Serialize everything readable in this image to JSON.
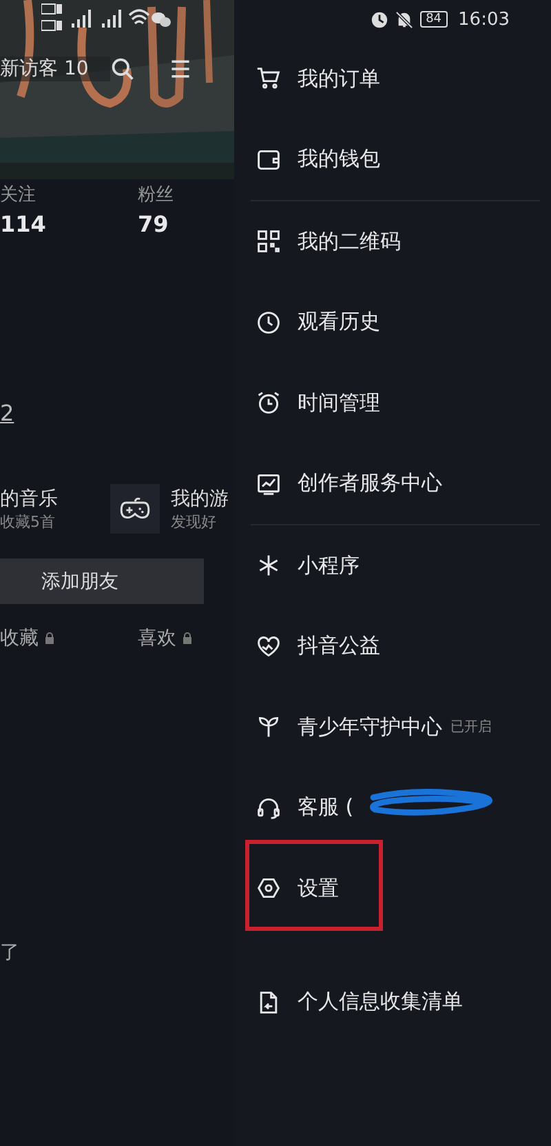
{
  "status_bar": {
    "battery": "84",
    "time": "16:03"
  },
  "profile": {
    "visitors": "新访客 10",
    "stats": [
      {
        "label": "关注",
        "value": "114"
      },
      {
        "label": "粉丝",
        "value": "79"
      }
    ],
    "name_fragment": "2",
    "shortcuts": [
      {
        "title": "的音乐",
        "subtitle": "收藏5首",
        "kind": "plain"
      },
      {
        "title": "我的游",
        "subtitle": "发现好",
        "kind": "game"
      }
    ],
    "add_friend": "添加朋友",
    "tabs": [
      {
        "label": "收藏",
        "locked": true
      },
      {
        "label": "喜欢",
        "locked": true
      }
    ],
    "empty_fragment": "了"
  },
  "drawer": {
    "groups": [
      [
        {
          "kind": "cart",
          "label": "我的订单"
        },
        {
          "kind": "wallet",
          "label": "我的钱包"
        }
      ],
      [
        {
          "kind": "qr",
          "label": "我的二维码"
        },
        {
          "kind": "clock",
          "label": "观看历史"
        },
        {
          "kind": "alarm",
          "label": "时间管理"
        },
        {
          "kind": "chart",
          "label": "创作者服务中心"
        }
      ],
      [
        {
          "kind": "asterisk",
          "label": "小程序"
        },
        {
          "kind": "heart",
          "label": "抖音公益"
        },
        {
          "kind": "sprout",
          "label": "青少年守护中心",
          "badge": "已开启"
        },
        {
          "kind": "headset",
          "label": "客服 (",
          "redacted": true
        },
        {
          "kind": "gear",
          "label": "设置",
          "highlighted": true
        }
      ],
      [
        {
          "kind": "doc",
          "label": "个人信息收集清单"
        }
      ]
    ]
  }
}
